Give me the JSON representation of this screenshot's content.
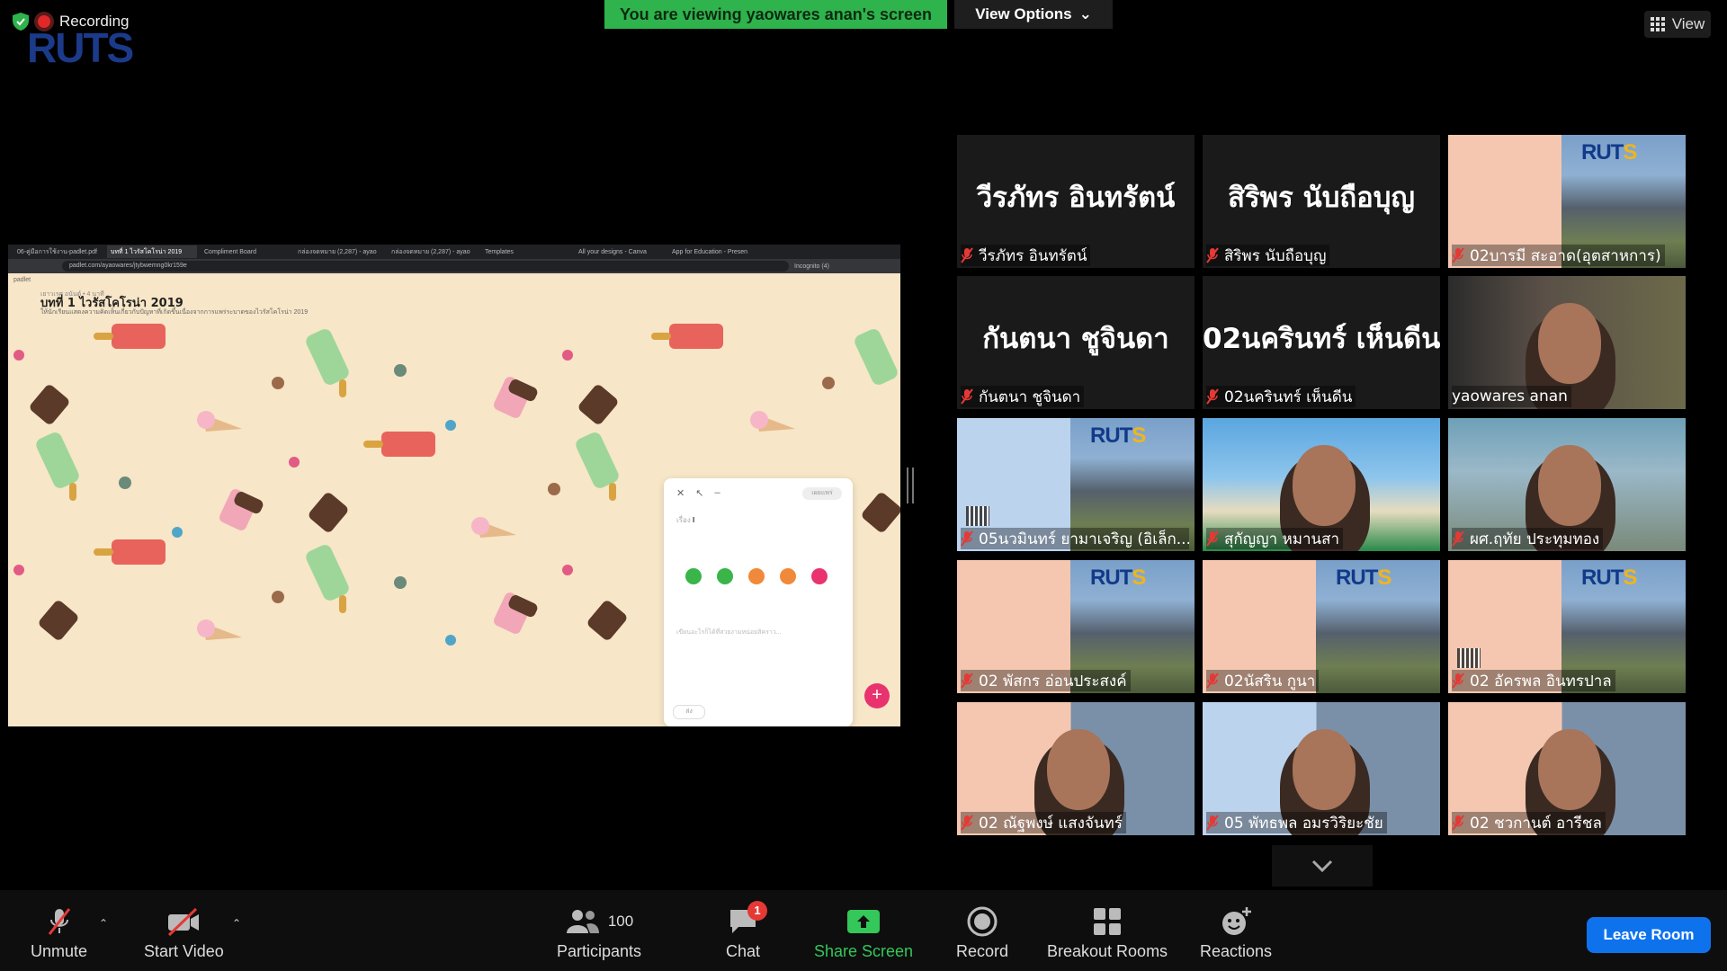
{
  "top": {
    "recording_label": "Recording",
    "logo_text": "RUTS",
    "banner": "You are viewing yaowares anan's screen",
    "view_options": "View Options",
    "view_label": "View"
  },
  "shared_screen": {
    "tabs": [
      "06-คู่มือการใช้งาน-padlet.pdf",
      "บทที่ 1 ไวรัสโคโรน่า 2019",
      "Compliment Board",
      "กล่องจดหมาย (2,287) - ayao",
      "กล่องจดหมาย (2,287) - ayao",
      "Templates",
      "All your designs - Canva",
      "App for Education - Presen"
    ],
    "url": "padlet.com/ayaowares/jtybwemng0kr159e",
    "profile": "Incognito (4)",
    "brand": "padlet",
    "author": "เยาวเรศ อนันต์ • 4 นาที",
    "title": "บทที่ 1 ไวรัสโคโรน่า 2019",
    "subtitle": "ให้นักเรียนแสดงความคิดเห็นเกี่ยวกับปัญหาที่เกิดขึ้นเนื่องจากการแพร่ระบาดของไวรัสโคโรน่า 2019",
    "card": {
      "publish": "เผยแพร่",
      "subject_label": "เรื่อง",
      "hint": "เขียนอะไรก็ได้ที่สวยงามหน่อยสิคราว...",
      "post": "ส่ง"
    }
  },
  "gallery": [
    {
      "big": "วีรภัทร อินทรัตน์",
      "label": "วีรภัทร อินทรัตน์",
      "type": "name"
    },
    {
      "big": "สิริพร นับถือบุญ",
      "label": "สิริพร นับถือบุญ",
      "type": "name"
    },
    {
      "label": "02บารมี สะอาด(อุตสาหการ)",
      "type": "slide"
    },
    {
      "big": "กันตนา ชูจินดา",
      "label": "กันตนา ชูจินดา",
      "type": "name"
    },
    {
      "big": "02นครินทร์ เห็นดีน",
      "label": "02นครินทร์ เห็นดีน",
      "type": "name"
    },
    {
      "label": "yaowares anan",
      "type": "video",
      "active": true
    },
    {
      "label": "05นวมินทร์ ยามาเจริญ (อิเล็ก...",
      "type": "slide"
    },
    {
      "label": "สุกัญญา หมานสา",
      "type": "video"
    },
    {
      "label": "ผศ.ฤทัย ประทุมทอง",
      "type": "video"
    },
    {
      "label": "02 พัสกร อ่อนประสงค์",
      "type": "slide"
    },
    {
      "label": "02นัสริน กูนา",
      "type": "slide"
    },
    {
      "label": "02 อัครพล อินทรปาล",
      "type": "slide"
    },
    {
      "label": "02 ณัฐพงษ์ แสงจันทร์",
      "type": "video"
    },
    {
      "label": "05 พัทธพล อมรวิริยะชัย",
      "type": "video"
    },
    {
      "label": "02 ชวกานต์ อารีชล",
      "type": "video"
    }
  ],
  "toolbar": {
    "unmute": "Unmute",
    "start_video": "Start Video",
    "participants": "Participants",
    "participants_count": "100",
    "chat": "Chat",
    "chat_badge": "1",
    "share_screen": "Share Screen",
    "record": "Record",
    "breakout_rooms": "Breakout Rooms",
    "reactions": "Reactions",
    "leave_room": "Leave Room"
  },
  "colors": {
    "banner_green": "#2fb34c",
    "active_speaker": "#d9f06e",
    "leave_blue": "#0e72ed",
    "muted_red": "#e53935",
    "padlet_bg": "#f7e6c7"
  }
}
